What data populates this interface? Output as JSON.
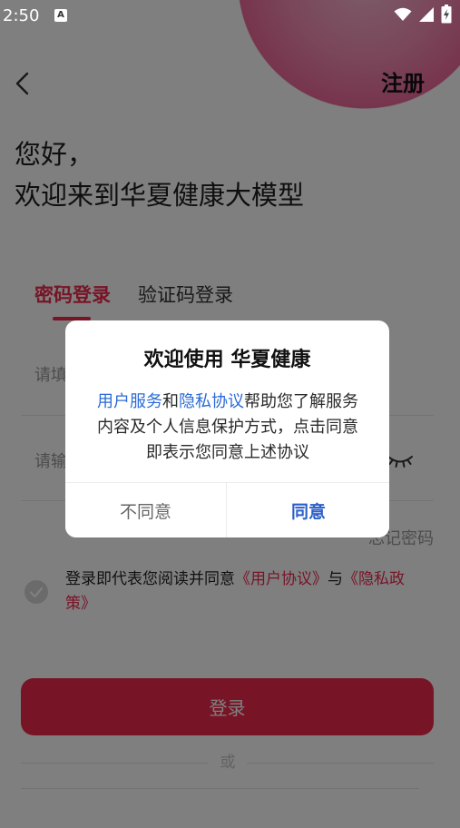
{
  "status_bar": {
    "time": "2:50",
    "notification_letter": "A",
    "icons": [
      "wifi-icon",
      "signal-icon",
      "battery-charging-icon"
    ]
  },
  "header": {
    "back_icon": "chevron-left-icon",
    "register_label": "注册"
  },
  "greeting": {
    "line1": "您好，",
    "line2": "欢迎来到华夏健康大模型"
  },
  "tabs": [
    {
      "label": "密码登录",
      "active": true
    },
    {
      "label": "验证码登录",
      "active": false
    }
  ],
  "form": {
    "account_placeholder": "请填",
    "password_placeholder": "请输",
    "password_toggle_icon": "eye-closed-icon",
    "forgot_password": "忘记密码"
  },
  "agreement": {
    "checked": false,
    "prefix": "登录即代表您阅读并同意",
    "user_agreement": "《用户协议》",
    "conjunction": "与",
    "privacy_policy": "《隐私政策》"
  },
  "login_button": "登录",
  "divider_text": "或",
  "dialog": {
    "title": "欢迎使用 华夏健康",
    "body": {
      "link1": "用户服务",
      "and": "和",
      "link2": "隐私协议",
      "rest": "帮助您了解服务内容及个人信息保护方式，点击同意即表示您同意上述协议"
    },
    "disagree_label": "不同意",
    "agree_label": "同意"
  },
  "colors": {
    "brand_red": "#ee2a4e",
    "link_blue": "#2b6bd6",
    "agree_blue": "#2a5fc9"
  }
}
